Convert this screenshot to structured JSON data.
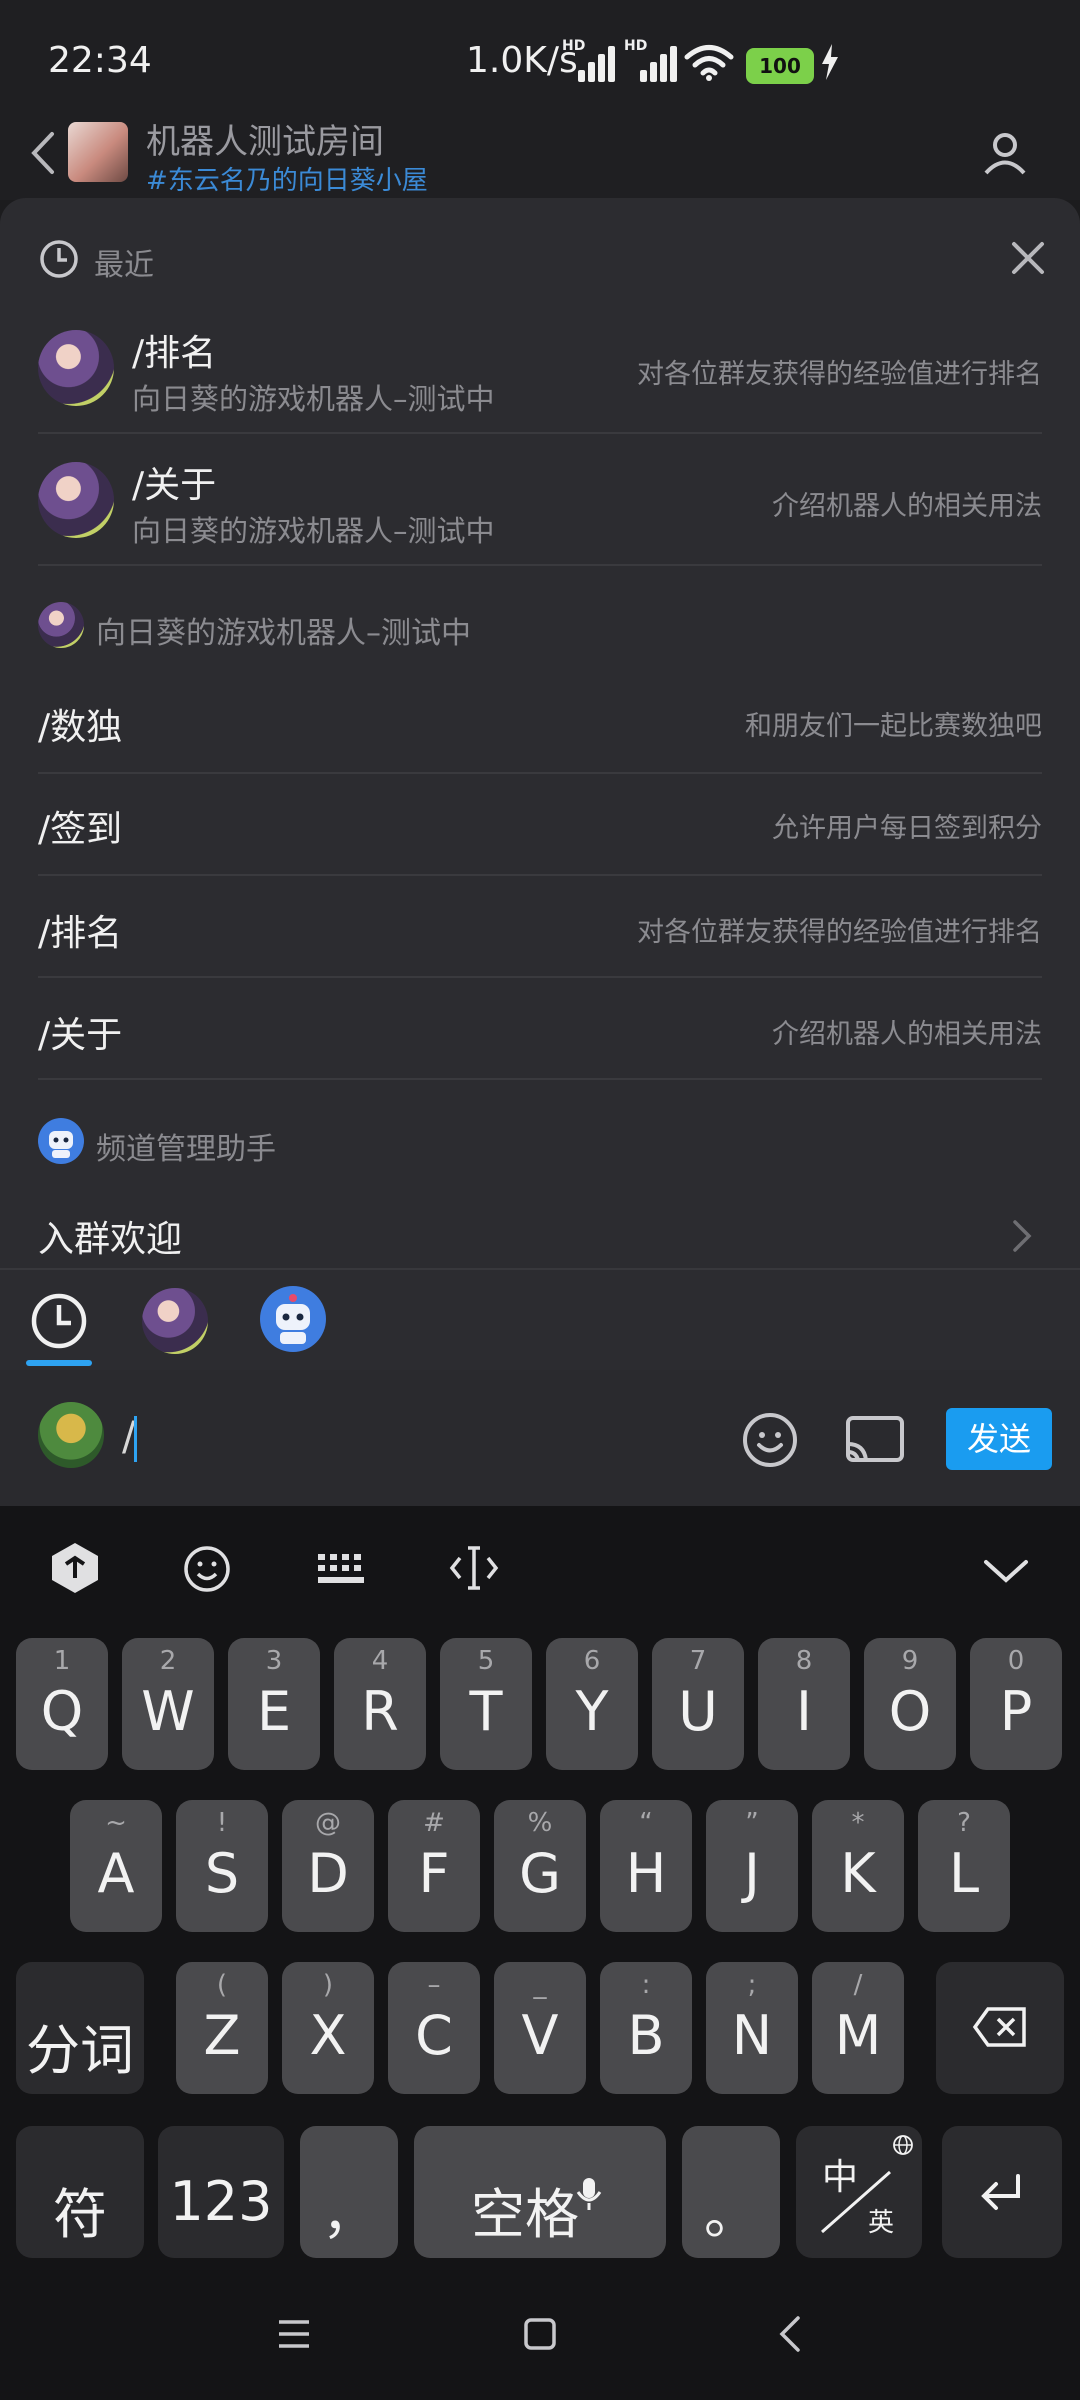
{
  "status": {
    "time": "22:34",
    "net_speed": "1.0K/s",
    "hd1": "HD",
    "hd2": "HD",
    "battery": "100"
  },
  "header": {
    "title": "机器人测试房间",
    "subtitle": "#东云名乃的向日葵小屋"
  },
  "recent": {
    "title": "最近",
    "items": [
      {
        "cmd": "/排名",
        "bot": "向日葵的游戏机器人–测试中",
        "desc": "对各位群友获得的经验值进行排名"
      },
      {
        "cmd": "/关于",
        "bot": "向日葵的游戏机器人–测试中",
        "desc": "介绍机器人的相关用法"
      }
    ]
  },
  "bot_section": {
    "title": "向日葵的游戏机器人–测试中",
    "items": [
      {
        "cmd": "/数独",
        "desc": "和朋友们一起比赛数独吧"
      },
      {
        "cmd": "/签到",
        "desc": "允许用户每日签到积分"
      },
      {
        "cmd": "/排名",
        "desc": "对各位群友获得的经验值进行排名"
      },
      {
        "cmd": "/关于",
        "desc": "介绍机器人的相关用法"
      }
    ]
  },
  "helper_section": {
    "title": "频道管理助手",
    "items": [
      {
        "cmd": "入群欢迎"
      }
    ]
  },
  "input": {
    "value": "/",
    "send_label": "发送"
  },
  "keyboard": {
    "row1": [
      [
        "1",
        "Q"
      ],
      [
        "2",
        "W"
      ],
      [
        "3",
        "E"
      ],
      [
        "4",
        "R"
      ],
      [
        "5",
        "T"
      ],
      [
        "6",
        "Y"
      ],
      [
        "7",
        "U"
      ],
      [
        "8",
        "I"
      ],
      [
        "9",
        "O"
      ],
      [
        "0",
        "P"
      ]
    ],
    "row2": [
      [
        "~",
        "A"
      ],
      [
        "!",
        "S"
      ],
      [
        "@",
        "D"
      ],
      [
        "#",
        "F"
      ],
      [
        "%",
        "G"
      ],
      [
        "“",
        "H"
      ],
      [
        "”",
        "J"
      ],
      [
        "*",
        "K"
      ],
      [
        "?",
        "L"
      ]
    ],
    "row3": [
      [
        "(",
        "Z"
      ],
      [
        ")",
        "X"
      ],
      [
        "–",
        "C"
      ],
      [
        "_",
        "V"
      ],
      [
        ":",
        "B"
      ],
      [
        ";",
        "N"
      ],
      [
        "/",
        "M"
      ]
    ],
    "segment": "分词",
    "symbols": "符",
    "numbers": "123",
    "comma": "，",
    "space": "空格",
    "period": "。",
    "lang_top": "中",
    "lang_bottom": "英"
  },
  "colors": {
    "accent": "#1a9cf0",
    "sheet": "#2c2c30",
    "keyboard": "#141416"
  }
}
